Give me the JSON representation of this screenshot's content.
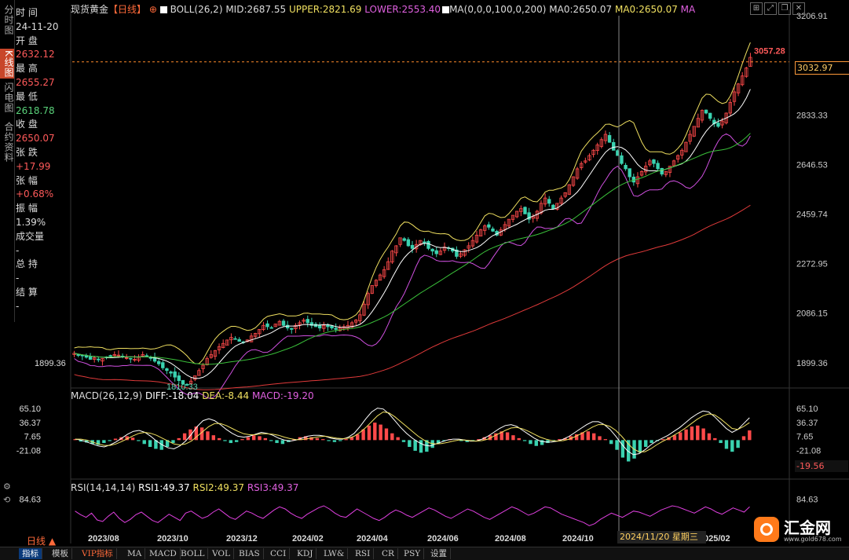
{
  "left_tabs": [
    "分时图",
    "K线图",
    "闪电图",
    "合约资料"
  ],
  "info": {
    "time_label": "时 间",
    "time_value": "24-11-20",
    "open_label": "开 盘",
    "open_value": "2632.12",
    "high_label": "最 高",
    "high_value": "2655.27",
    "low_label": "最 低",
    "low_value": "2618.78",
    "close_label": "收 盘",
    "close_value": "2650.07",
    "change_label": "张 跌",
    "change_value": "+17.99",
    "pct_label": "张 幅",
    "pct_value": "+0.68%",
    "amp_label": "振 幅",
    "amp_value": "1.39%",
    "vol_label": "成交量",
    "vol_value": "-",
    "oi_label": "总 持",
    "oi_value": "-",
    "settle_label": "结 算",
    "settle_value": "-"
  },
  "header": {
    "title": "现货黄金",
    "period": "【日线】",
    "boll": "BOLL(26,2)",
    "mid": "MID:2687.55",
    "upper": "UPPER:2821.69",
    "lower": "LOWER:2553.40",
    "ma": "MA(0,0,0,100,0,200)",
    "ma0a": "MA0:2650.07",
    "ma0b": "MA0:2650.07",
    "ma_tail": "MA"
  },
  "macd_header": {
    "name": "MACD(26,12,9)",
    "diff": "DIFF:-18.04",
    "dea": "DEA:-8.44",
    "macd": "MACD:-19.20"
  },
  "rsi_header": {
    "name": "RSI(14,14,14)",
    "rsi1": "RSI1:49.37",
    "rsi2": "RSI2:49.37",
    "rsi3": "RSI3:49.37"
  },
  "price_tag": "3032.97",
  "macd_tag": "-19.56",
  "date_tag": "2024/11/20 星期三",
  "logo_text": "汇金网",
  "logo_url": "www.gold678.com",
  "bottom_left": "日线 ▲",
  "toolbar": [
    "指标",
    "模板",
    "VIP指标",
    "MA",
    "MACD",
    "BOLL",
    "VOL",
    "BIAS",
    "CCI",
    "KDJ",
    "LW&",
    "RSI",
    "CR",
    "PSY",
    "设置"
  ],
  "colors": {
    "up": "#ff4a4a",
    "down": "#3ad2b0",
    "boll_mid": "#ffffff",
    "boll_upper": "#f0e060",
    "boll_lower": "#d050e0",
    "ma100": "#3ac03a",
    "ma200": "#e03a3a",
    "accent": "#ff8a2a"
  },
  "chart_data": [
    {
      "type": "candlestick",
      "title": "现货黄金 日线",
      "ylim": [
        1810,
        3207
      ],
      "y_ticks": [
        "3206.91",
        "2833.33",
        "2646.53",
        "2459.74",
        "2272.95",
        "2086.15",
        "1899.36"
      ],
      "y_tick_values": [
        3206.91,
        2833.33,
        2646.53,
        2459.74,
        2272.95,
        2086.15,
        1899.36
      ],
      "x_ticks": [
        "2023/08",
        "2023/10",
        "2023/12",
        "2024/02",
        "2024/04",
        "2024/06",
        "2024/08",
        "2024/10",
        "025/02"
      ],
      "annotations": [
        {
          "text": "3057.28",
          "y": 3057.28
        },
        {
          "text": "1810.33",
          "y": 1810.33
        }
      ],
      "left_label": "1899.36",
      "close_series": [
        1935,
        1928,
        1925,
        1920,
        1912,
        1918,
        1910,
        1915,
        1920,
        1925,
        1930,
        1928,
        1922,
        1918,
        1915,
        1912,
        1920,
        1930,
        1925,
        1918,
        1905,
        1895,
        1880,
        1870,
        1860,
        1845,
        1832,
        1820,
        1818,
        1830,
        1850,
        1870,
        1890,
        1915,
        1930,
        1945,
        1960,
        1972,
        1985,
        1995,
        1990,
        1980,
        1975,
        1985,
        2000,
        2010,
        2025,
        2040,
        2035,
        2030,
        2045,
        2055,
        2040,
        2030,
        2025,
        2040,
        2050,
        2060,
        2050,
        2040,
        2035,
        2030,
        2040,
        2035,
        2030,
        2025,
        2030,
        2035,
        2040,
        2050,
        2060,
        2080,
        2120,
        2160,
        2190,
        2210,
        2230,
        2250,
        2280,
        2320,
        2340,
        2370,
        2360,
        2340,
        2330,
        2345,
        2360,
        2350,
        2330,
        2320,
        2310,
        2320,
        2335,
        2330,
        2320,
        2300,
        2310,
        2325,
        2340,
        2360,
        2380,
        2400,
        2415,
        2410,
        2395,
        2380,
        2400,
        2420,
        2440,
        2455,
        2470,
        2480,
        2460,
        2440,
        2450,
        2470,
        2500,
        2520,
        2500,
        2480,
        2500,
        2520,
        2540,
        2570,
        2600,
        2630,
        2650,
        2660,
        2680,
        2700,
        2720,
        2740,
        2760,
        2730,
        2700,
        2680,
        2650,
        2630,
        2600,
        2580,
        2600,
        2620,
        2640,
        2660,
        2650,
        2630,
        2610,
        2620,
        2640,
        2660,
        2680,
        2700,
        2730,
        2760,
        2790,
        2820,
        2850,
        2840,
        2820,
        2800,
        2790,
        2810,
        2840,
        2880,
        2920,
        2950,
        2980,
        3010,
        3050
      ],
      "boll_mid": 2687.55,
      "boll_upper": 2821.69,
      "boll_lower": 2553.4,
      "ma0": 2650.07
    },
    {
      "type": "bar",
      "title": "MACD(26,12,9)",
      "ylim": [
        -48,
        75
      ],
      "y_ticks": [
        "65.10",
        "36.37",
        "7.65",
        "-21.08"
      ],
      "y_tick_values": [
        65.1,
        36.37,
        7.65,
        -21.08
      ],
      "diff": -18.04,
      "dea": -8.44,
      "macd": -19.2,
      "histogram": [
        2,
        -3,
        -5,
        -8,
        -10,
        -6,
        -2,
        3,
        6,
        8,
        5,
        -2,
        -8,
        -14,
        -18,
        -20,
        -14,
        -6,
        4,
        14,
        22,
        28,
        26,
        18,
        10,
        4,
        -2,
        -6,
        -4,
        2,
        6,
        10,
        8,
        4,
        -2,
        -6,
        -8,
        -4,
        2,
        6,
        8,
        6,
        4,
        2,
        -2,
        -4,
        -2,
        2,
        6,
        12,
        22,
        30,
        36,
        32,
        24,
        14,
        6,
        -4,
        -14,
        -22,
        -26,
        -24,
        -16,
        -8,
        -2,
        2,
        0,
        -2,
        -4,
        -2,
        2,
        6,
        10,
        14,
        18,
        16,
        10,
        4,
        -2,
        -8,
        -12,
        -10,
        -6,
        -2,
        2,
        4,
        8,
        12,
        16,
        18,
        14,
        8,
        2,
        -8,
        -20,
        -36,
        -44,
        -38,
        -26,
        -14,
        -6,
        -2,
        2,
        6,
        10,
        16,
        22,
        28,
        30,
        24,
        14,
        4,
        -6,
        -18,
        -24,
        -16,
        8,
        20
      ],
      "diff_series": [
        2,
        0,
        -4,
        -8,
        -12,
        -14,
        -10,
        -4,
        4,
        12,
        18,
        20,
        16,
        8,
        -2,
        -10,
        -16,
        -18,
        -12,
        -2,
        12,
        28,
        40,
        44,
        40,
        32,
        22,
        14,
        8,
        6,
        8,
        12,
        16,
        14,
        10,
        4,
        0,
        -2,
        0,
        4,
        8,
        10,
        10,
        8,
        4,
        2,
        2,
        6,
        14,
        28,
        44,
        58,
        66,
        64,
        54,
        40,
        26,
        14,
        4,
        -4,
        -10,
        -12,
        -8,
        -4,
        0,
        2,
        2,
        0,
        -2,
        -2,
        2,
        8,
        16,
        24,
        30,
        32,
        28,
        20,
        12,
        4,
        -2,
        -4,
        -4,
        -2,
        2,
        8,
        16,
        24,
        32,
        38,
        38,
        32,
        22,
        8,
        -8,
        -22,
        -30,
        -28,
        -20,
        -10,
        -2,
        4,
        10,
        18,
        26,
        36,
        46,
        54,
        60,
        58,
        48,
        36,
        24,
        16,
        22,
        34,
        46
      ],
      "dea_series": [
        2,
        2,
        0,
        -4,
        -8,
        -11,
        -11,
        -8,
        -3,
        3,
        9,
        14,
        16,
        14,
        10,
        4,
        -2,
        -8,
        -10,
        -8,
        -2,
        8,
        18,
        28,
        34,
        34,
        30,
        24,
        18,
        13,
        11,
        11,
        13,
        13,
        12,
        10,
        6,
        3,
        1,
        1,
        3,
        5,
        7,
        8,
        6,
        4,
        3,
        4,
        8,
        16,
        26,
        38,
        50,
        58,
        56,
        48,
        38,
        28,
        18,
        8,
        0,
        -6,
        -8,
        -7,
        -5,
        -2,
        0,
        0,
        -1,
        -2,
        -1,
        2,
        8,
        14,
        20,
        25,
        26,
        23,
        18,
        12,
        6,
        2,
        -1,
        -2,
        -1,
        2,
        7,
        13,
        20,
        27,
        32,
        32,
        28,
        20,
        8,
        -6,
        -18,
        -24,
        -24,
        -18,
        -10,
        -3,
        3,
        10,
        17,
        25,
        34,
        43,
        50,
        54,
        52,
        44,
        34,
        24,
        22,
        28,
        36
      ]
    },
    {
      "type": "line",
      "title": "RSI(14,14,14)",
      "y_ticks": [
        "84.63"
      ],
      "y_tick_values": [
        84.63
      ],
      "rsi1": 49.37,
      "rsi2": 49.37,
      "rsi3": 49.37,
      "series": [
        62,
        55,
        50,
        58,
        45,
        42,
        52,
        60,
        48,
        40,
        46,
        55,
        60,
        52,
        44,
        40,
        48,
        56,
        50,
        44,
        58,
        62,
        55,
        48,
        52,
        60,
        66,
        58,
        50,
        46,
        54,
        62,
        58,
        52,
        48,
        56,
        64,
        70,
        66,
        58,
        52,
        48,
        56,
        62,
        68,
        72,
        66,
        58,
        52,
        50,
        58,
        66,
        60,
        54,
        48,
        44,
        50,
        58,
        64,
        60,
        54,
        50,
        56,
        62,
        68,
        64,
        58,
        52,
        48,
        54,
        60,
        66,
        62,
        56,
        50,
        46,
        52,
        58,
        64,
        70,
        66,
        60,
        54,
        58,
        64,
        70,
        68,
        62,
        56,
        52,
        48,
        44,
        40,
        34,
        38,
        46,
        52,
        58,
        54,
        50,
        56,
        62,
        60,
        56,
        52,
        58,
        64,
        68,
        72,
        70,
        66,
        62,
        58,
        64,
        70,
        66,
        60,
        56,
        62,
        68,
        64,
        60,
        70
      ]
    }
  ]
}
